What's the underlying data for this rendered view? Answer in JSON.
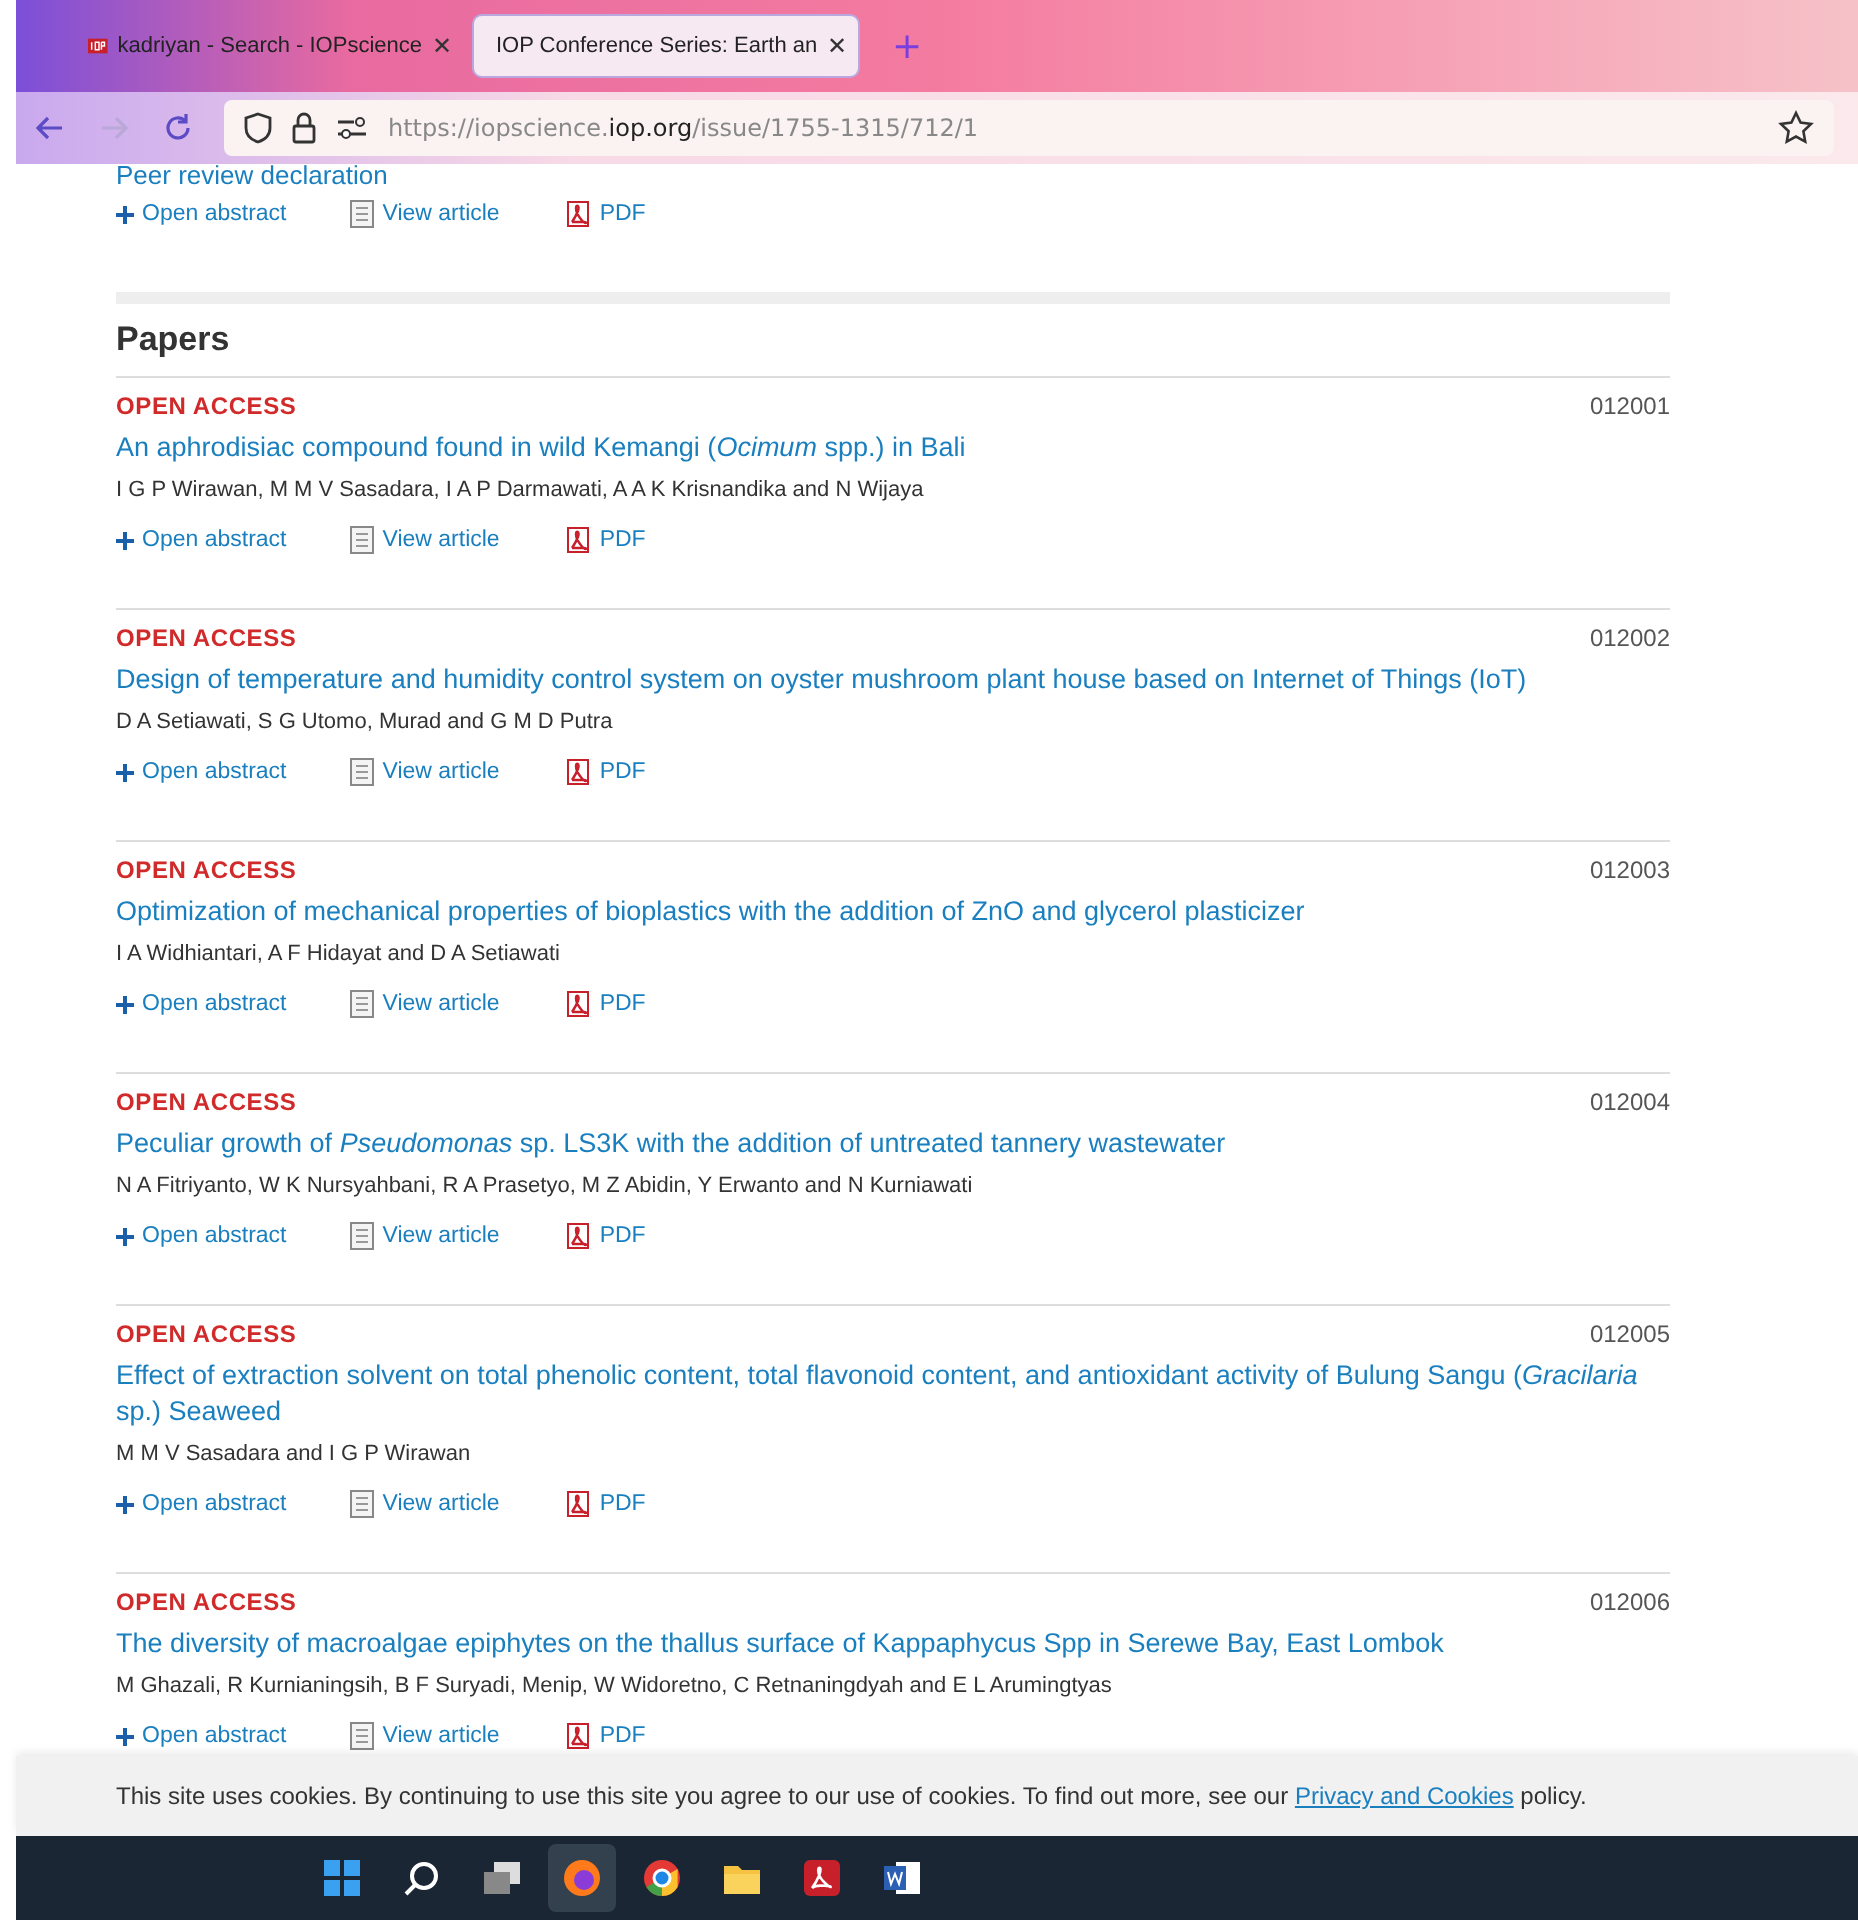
{
  "tabs": [
    {
      "label": "kadriyan - Search - IOPscience",
      "close": "✕",
      "selected": false
    },
    {
      "label": "IOP Conference Series: Earth an",
      "close": "✕",
      "selected": true
    }
  ],
  "new_tab": "+",
  "address_bar": {
    "url_prefix": "https://iopscience.",
    "url_domain": "iop.org",
    "url_path": "/issue/1755-1315/712/1"
  },
  "top_item": {
    "title": "Peer review declaration",
    "actions": [
      {
        "kind": "abstract",
        "label": "Open abstract"
      },
      {
        "kind": "article",
        "label": "View article"
      },
      {
        "kind": "pdf",
        "label": "PDF"
      }
    ]
  },
  "section_title": "Papers",
  "papers": [
    {
      "access": "OPEN ACCESS",
      "number": "012001",
      "title": "An aphrodisiac compound found in wild Kemangi (*Ocimum* spp.) in Bali",
      "authors": "I G P Wirawan, M M V Sasadara, I A P Darmawati, A A K Krisnandika and N Wijaya",
      "actions": [
        {
          "kind": "abstract",
          "label": "Open abstract"
        },
        {
          "kind": "article",
          "label": "View article"
        },
        {
          "kind": "pdf",
          "label": "PDF"
        }
      ]
    },
    {
      "access": "OPEN ACCESS",
      "number": "012002",
      "title": "Design of temperature and humidity control system on oyster mushroom plant house based on Internet of Things (IoT)",
      "authors": "D A Setiawati, S G Utomo, Murad and G M D Putra",
      "actions": [
        {
          "kind": "abstract",
          "label": "Open abstract"
        },
        {
          "kind": "article",
          "label": "View article"
        },
        {
          "kind": "pdf",
          "label": "PDF"
        }
      ]
    },
    {
      "access": "OPEN ACCESS",
      "number": "012003",
      "title": "Optimization of mechanical properties of bioplastics with the addition of ZnO and glycerol plasticizer",
      "authors": "I A Widhiantari, A F Hidayat and D A Setiawati",
      "actions": [
        {
          "kind": "abstract",
          "label": "Open abstract"
        },
        {
          "kind": "article",
          "label": "View article"
        },
        {
          "kind": "pdf",
          "label": "PDF"
        }
      ]
    },
    {
      "access": "OPEN ACCESS",
      "number": "012004",
      "title": "Peculiar growth of *Pseudomonas* sp. LS3K with the addition of untreated tannery wastewater",
      "authors": "N A Fitriyanto, W K Nursyahbani, R A Prasetyo, M Z Abidin, Y Erwanto and N Kurniawati",
      "actions": [
        {
          "kind": "abstract",
          "label": "Open abstract"
        },
        {
          "kind": "article",
          "label": "View article"
        },
        {
          "kind": "pdf",
          "label": "PDF"
        }
      ]
    },
    {
      "access": "OPEN ACCESS",
      "number": "012005",
      "title": "Effect of extraction solvent on total phenolic content, total flavonoid content, and antioxidant activity of Bulung Sangu (*Gracilaria* sp.) Seaweed",
      "authors": "M M V Sasadara and I G P Wirawan",
      "actions": [
        {
          "kind": "abstract",
          "label": "Open abstract"
        },
        {
          "kind": "article",
          "label": "View article"
        },
        {
          "kind": "pdf",
          "label": "PDF"
        }
      ]
    },
    {
      "access": "OPEN ACCESS",
      "number": "012006",
      "title": "The diversity of macroalgae epiphytes on the thallus surface of Kappaphycus Spp in Serewe Bay, East Lombok",
      "authors": "M Ghazali, R Kurnianingsih, B F Suryadi, Menip, W Widoretno, C Retnaningdyah and E L Arumingtyas",
      "actions": [
        {
          "kind": "abstract",
          "label": "Open abstract"
        },
        {
          "kind": "article",
          "label": "View article"
        },
        {
          "kind": "pdf",
          "label": "PDF"
        }
      ]
    }
  ],
  "cookie_notice": {
    "text": "This site uses cookies. By continuing to use this site you agree to our use of cookies. To find out more, see our",
    "link": "Privacy and Cookies",
    "suffix": "policy."
  },
  "taskbar": [
    {
      "kind": "start",
      "selected": false
    },
    {
      "kind": "search",
      "selected": false
    },
    {
      "kind": "taskview",
      "selected": false
    },
    {
      "kind": "firefox",
      "selected": true
    },
    {
      "kind": "chrome",
      "selected": false
    },
    {
      "kind": "files",
      "selected": false
    },
    {
      "kind": "acrobat",
      "selected": false
    },
    {
      "kind": "word",
      "selected": false
    }
  ]
}
